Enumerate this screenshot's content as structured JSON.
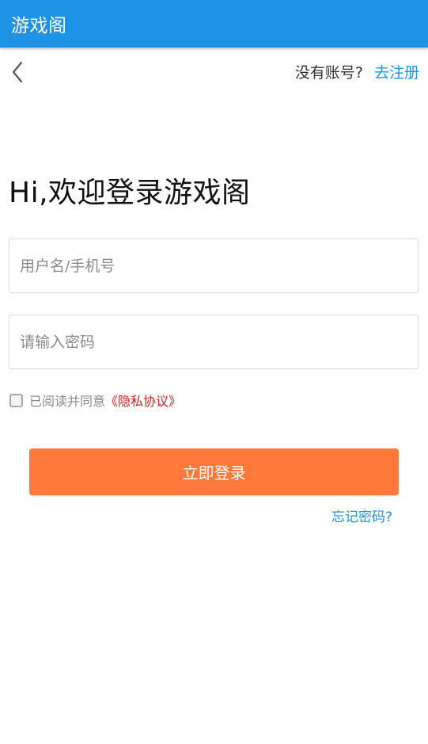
{
  "appbar": {
    "title": "游戏阁"
  },
  "header": {
    "back_icon": "chevron-left-icon",
    "no_account_text": "没有账号?",
    "register_label": "去注册"
  },
  "welcome": {
    "text": "Hi,欢迎登录游戏阁"
  },
  "form": {
    "username_placeholder": "用户名/手机号",
    "username_value": "",
    "password_placeholder": "请输入密码",
    "password_value": ""
  },
  "agreement": {
    "checked": false,
    "text": "已阅读并同意",
    "privacy_label": "《隐私协议》"
  },
  "actions": {
    "login_label": "立即登录",
    "forgot_label": "忘记密码?"
  },
  "colors": {
    "appbar": "#1e93e6",
    "link": "#1e93e6",
    "primary_button": "#ff7a3a",
    "privacy_link": "#e02020"
  }
}
